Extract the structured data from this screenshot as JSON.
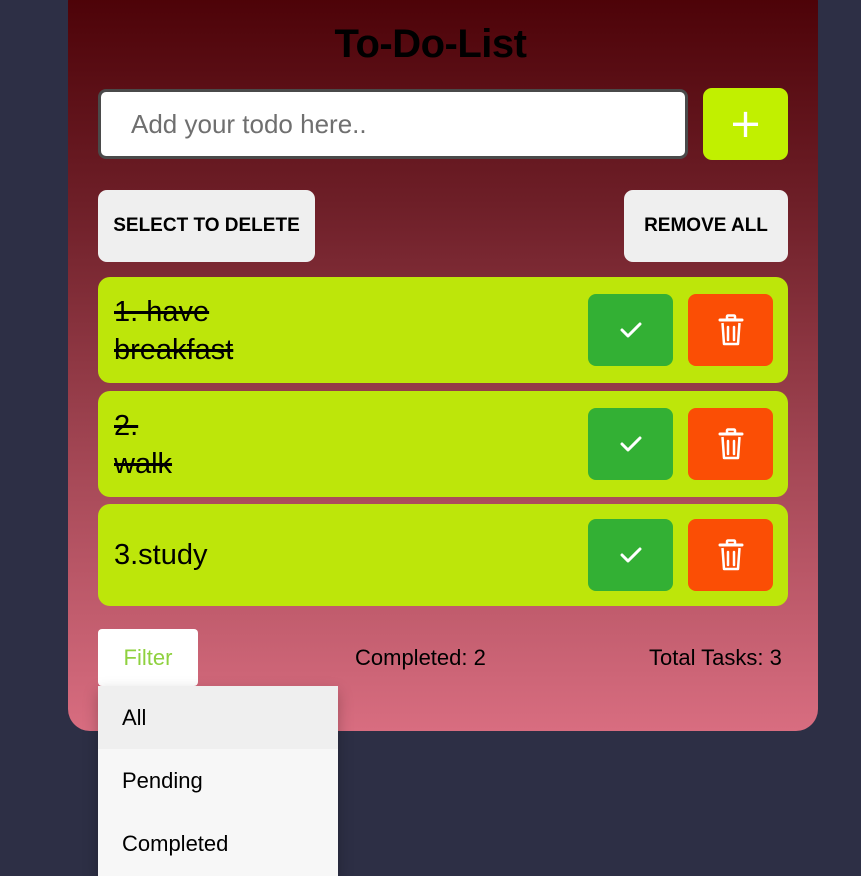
{
  "app": {
    "title": "To-Do-List"
  },
  "input": {
    "placeholder": "Add your todo here..",
    "value": ""
  },
  "add_button": {
    "icon": "plus-icon",
    "label": "+"
  },
  "actions": {
    "select_to_delete": "SELECT TO DELETE",
    "remove_all": "REMOVE ALL"
  },
  "todos": [
    {
      "line1": "1. have",
      "line2": "breakfast",
      "completed": true
    },
    {
      "line1": "2.",
      "line2": "walk",
      "completed": true
    },
    {
      "line1": "3.study",
      "line2": "",
      "completed": false
    }
  ],
  "footer": {
    "filter_label": "Filter",
    "completed_text": "Completed: 2",
    "total_text": "Total Tasks: 3"
  },
  "filter_menu": {
    "options": [
      "All",
      "Pending",
      "Completed"
    ],
    "highlighted": "All"
  },
  "colors": {
    "background": "#2d2f45",
    "card_top": "#4a0005",
    "card_bottom": "#d86d80",
    "accent_green": "#c1f000",
    "item_bg": "#bde60a",
    "check_green": "#33b034",
    "delete_orange": "#fb4e05",
    "filter_text": "#8fd13f"
  },
  "icons": {
    "complete": "check-icon",
    "delete": "trash-icon"
  }
}
